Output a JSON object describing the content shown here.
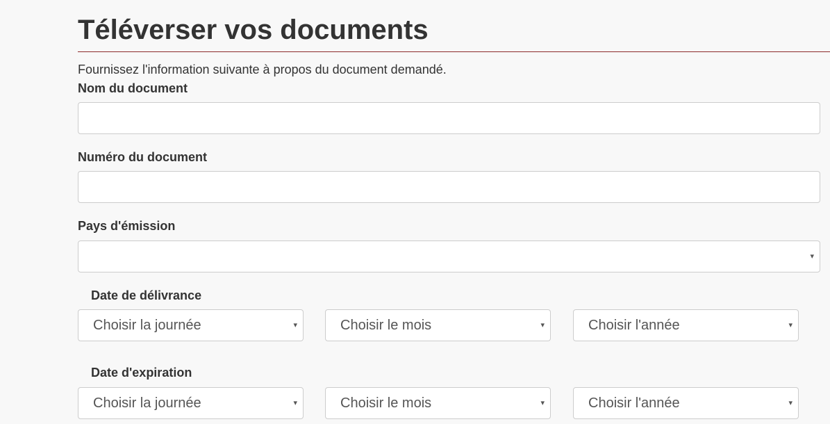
{
  "page": {
    "title": "Téléverser vos documents",
    "intro": "Fournissez l'information suivante à propos du document demandé."
  },
  "fields": {
    "doc_name": {
      "label": "Nom du document",
      "value": ""
    },
    "doc_number": {
      "label": "Numéro du document",
      "value": ""
    },
    "country": {
      "label": "Pays d'émission",
      "value": ""
    }
  },
  "issue_date": {
    "label": "Date de délivrance",
    "day": "Choisir la journée",
    "month": "Choisir le mois",
    "year": "Choisir l'année"
  },
  "expiry_date": {
    "label": "Date d'expiration",
    "day": "Choisir la journée",
    "month": "Choisir le mois",
    "year": "Choisir l'année"
  },
  "icons": {
    "caret": "▾"
  },
  "colors": {
    "title_rule": "#8b2a2a",
    "text": "#333333",
    "background": "#f8f8f8"
  }
}
